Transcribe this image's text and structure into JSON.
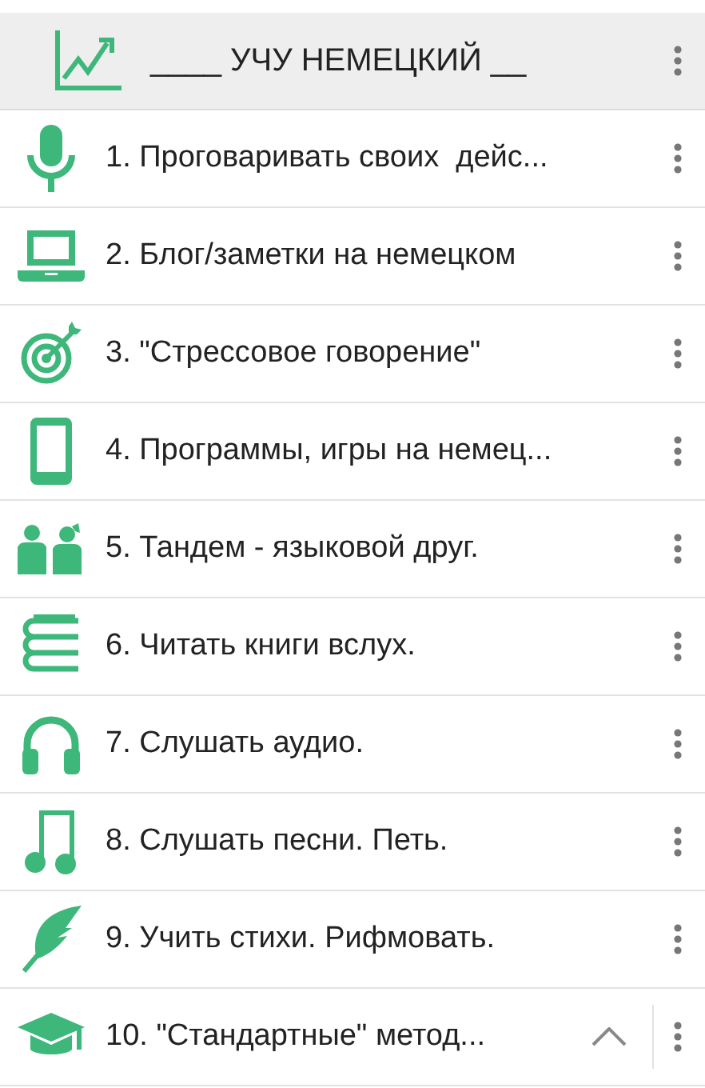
{
  "header": {
    "title": "____ УЧУ НЕМЕЦКИЙ __"
  },
  "items": [
    {
      "label": "1. Проговаривать своих  дейс...",
      "kind": "mic"
    },
    {
      "label": "2. Блог/заметки на немецком",
      "kind": "laptop"
    },
    {
      "label": "3. \"Стрессовое говорение\"",
      "kind": "target"
    },
    {
      "label": "4. Программы, игры на немец...",
      "kind": "phone"
    },
    {
      "label": "5. Тандем - языковой друг.",
      "kind": "people"
    },
    {
      "label": "6. Читать книги вслух.",
      "kind": "books"
    },
    {
      "label": "7. Слушать аудио.",
      "kind": "headphones"
    },
    {
      "label": "8. Слушать песни. Петь.",
      "kind": "music"
    },
    {
      "label": "9. Учить стихи. Рифмовать.",
      "kind": "feather"
    },
    {
      "label": "10. \"Стандартные\" метод...",
      "kind": "cap",
      "collapsible": true
    }
  ]
}
